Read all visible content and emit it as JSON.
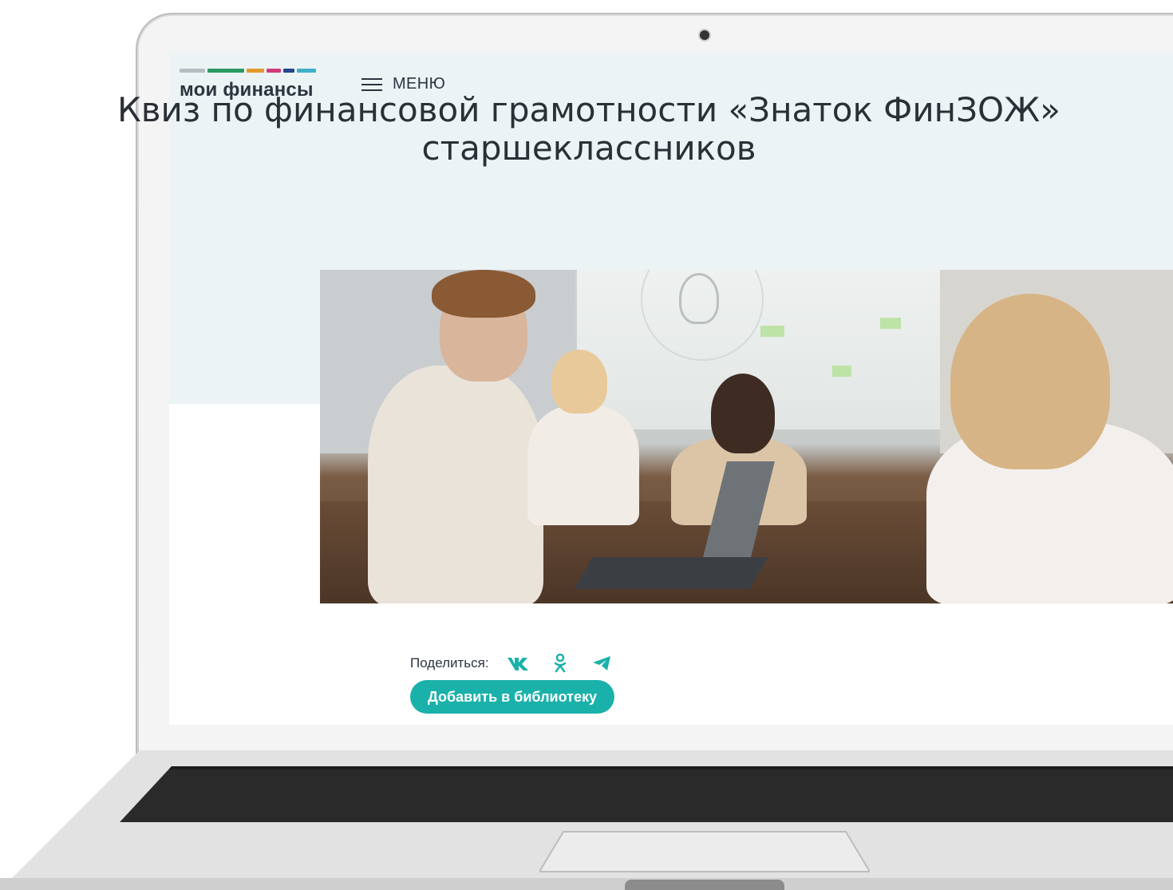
{
  "logo": {
    "text": "мои финансы",
    "stripes": [
      "#b7bcc2",
      "#2a9a63",
      "#e49a2a",
      "#d23a7a",
      "#25468f",
      "#3fb0c7"
    ]
  },
  "header": {
    "menu_label": "МЕНЮ",
    "menu_icon": "hamburger-icon"
  },
  "article": {
    "title_line1": "Квиз по финансовой грамотности «Знаток ФинЗОЖ»",
    "title_line2": "старшеклассников",
    "photo_icon": "students-photo"
  },
  "share": {
    "label": "Поделиться:",
    "icons": [
      "vk-icon",
      "odnoklassniki-icon",
      "telegram-icon"
    ],
    "color": "#1ab1aa"
  },
  "actions": {
    "add_to_library": "Добавить в библиотеку"
  },
  "theme": {
    "accent": "#1ab1aa",
    "band": "#ebf3f5",
    "text": "#2c3440"
  }
}
